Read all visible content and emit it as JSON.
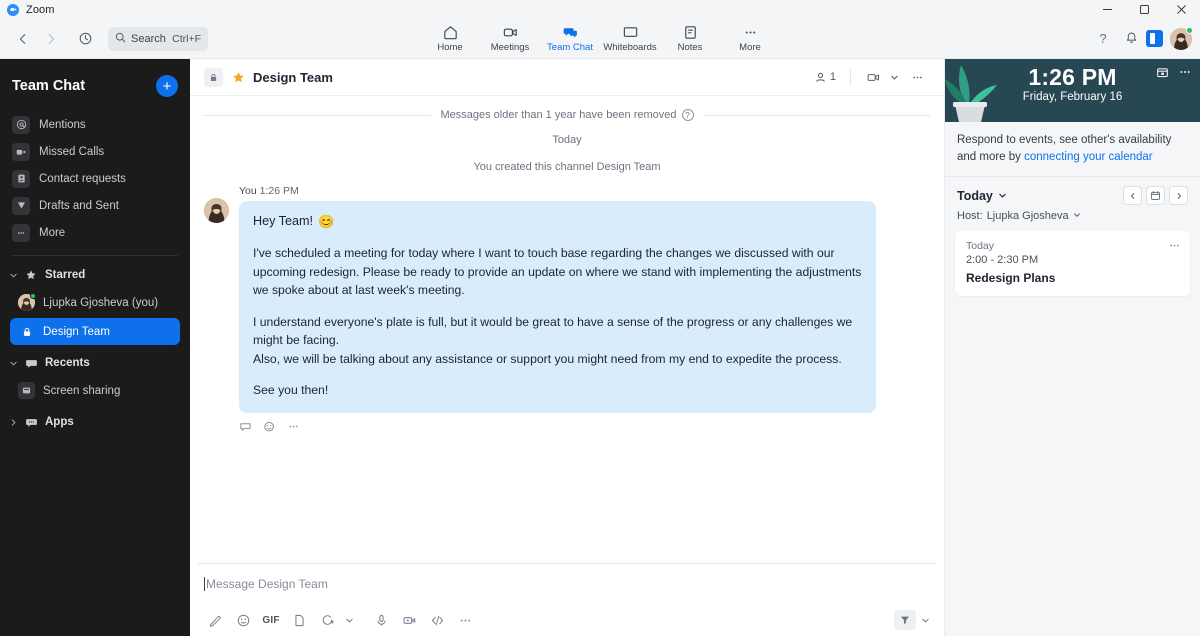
{
  "titlebar": {
    "app_name": "Zoom",
    "minimize": "minimize-window",
    "maximize": "maximize-window",
    "close": "close-window"
  },
  "toolbar": {
    "back": "back",
    "forward": "forward",
    "history": "history",
    "search_label": "Search",
    "search_shortcut": "Ctrl+F",
    "nav": [
      {
        "label": "Home",
        "icon": "home-icon",
        "active": false
      },
      {
        "label": "Meetings",
        "icon": "video-camera-icon",
        "active": false
      },
      {
        "label": "Team Chat",
        "icon": "team-chat-icon",
        "active": true
      },
      {
        "label": "Whiteboards",
        "icon": "whiteboard-icon",
        "active": false
      },
      {
        "label": "Notes",
        "icon": "notes-icon",
        "active": false
      },
      {
        "label": "More",
        "icon": "ellipsis-icon",
        "active": false
      }
    ],
    "help": "?",
    "notifications": "bell-icon",
    "panel_toggle": "side-panel-icon",
    "profile": "user-avatar"
  },
  "sidebar": {
    "title": "Team Chat",
    "add_label": "+",
    "items": [
      {
        "label": "Mentions",
        "icon": "at-icon"
      },
      {
        "label": "Missed Calls",
        "icon": "video-camera-icon"
      },
      {
        "label": "Contact requests",
        "icon": "contact-card-icon"
      },
      {
        "label": "Drafts and Sent",
        "icon": "send-icon"
      },
      {
        "label": "More",
        "icon": "ellipsis-icon"
      }
    ],
    "groups": [
      {
        "label": "Starred",
        "icon": "star-icon",
        "expanded": true,
        "rows": [
          {
            "label": "Ljupka Gjosheva (you)",
            "icon": "user-avatar",
            "selected": false
          },
          {
            "label": "Design Team",
            "icon": "lock-icon",
            "selected": true
          }
        ]
      },
      {
        "label": "Recents",
        "icon": "chat-bubble-icon",
        "expanded": true,
        "rows": [
          {
            "label": "Screen sharing",
            "icon": "screen-share-icon",
            "selected": false
          }
        ]
      },
      {
        "label": "Apps",
        "icon": "apps-bubble-icon",
        "expanded": false,
        "rows": []
      }
    ]
  },
  "chat": {
    "header": {
      "lock": "lock-icon",
      "star": "star-icon",
      "title": "Design Team",
      "member_count": "1",
      "video_label": "start-video-meeting",
      "more_label": "more-options"
    },
    "system_divider": "Messages older than 1 year have been removed",
    "day_label": "Today",
    "channel_created": "You created this channel Design Team",
    "message": {
      "author": "You",
      "time": "1:26 PM",
      "greeting": "Hey Team!",
      "greeting_emoji": "😊",
      "paragraphs": [
        "I've scheduled a meeting for today where I want to touch base regarding the changes we discussed with our upcoming redesign. Please be ready to provide an update on where we stand with implementing the adjustments we spoke about at last week's meeting.",
        "I understand everyone's plate is full, but it would be great to have a sense of the progress or any challenges we might be facing.\nAlso, we will be talking about any assistance or support you might need from my end to expedite the process.",
        "See you then!"
      ],
      "actions": [
        "reply-icon",
        "add-reaction-icon",
        "more-actions-icon"
      ]
    },
    "composer": {
      "placeholder": "Message Design Team",
      "tools": [
        {
          "name": "format-text-icon",
          "label": ""
        },
        {
          "name": "emoji-icon",
          "label": ""
        },
        {
          "name": "gif-icon",
          "label": "GIF"
        },
        {
          "name": "file-icon",
          "label": ""
        },
        {
          "name": "screenshot-icon",
          "label": ""
        },
        {
          "name": "screenshot-chevron-icon",
          "label": ""
        },
        {
          "name": "audio-message-icon",
          "label": ""
        },
        {
          "name": "video-message-icon",
          "label": ""
        },
        {
          "name": "code-snippet-icon",
          "label": ""
        },
        {
          "name": "more-tools-icon",
          "label": ""
        }
      ],
      "send_icon": "send-icon",
      "send_chevron": "chevron-down-icon"
    }
  },
  "right_panel": {
    "clock": "1:26 PM",
    "date": "Friday, February 16",
    "hero_buttons": [
      "calendar-toggle-icon",
      "more-options-icon"
    ],
    "note_prefix": "Respond to events, see other's availability and more by ",
    "note_link": "connecting your calendar",
    "today_label": "Today",
    "host_label": "Host:",
    "host_name": "Ljupka Gjosheva",
    "nav": {
      "prev": "chevron-left-icon",
      "calendar": "calendar-icon",
      "next": "chevron-right-icon"
    },
    "events": [
      {
        "day": "Today",
        "time": "2:00 - 2:30 PM",
        "title": "Redesign Plans",
        "more": "event-more-icon"
      }
    ]
  },
  "colors": {
    "accent": "#0e71eb",
    "bubble": "#d9ecfb",
    "sidebar_bg": "#1b1b1b",
    "hero_bg": "#274753",
    "star": "#f5a623",
    "presence": "#22c55e"
  }
}
